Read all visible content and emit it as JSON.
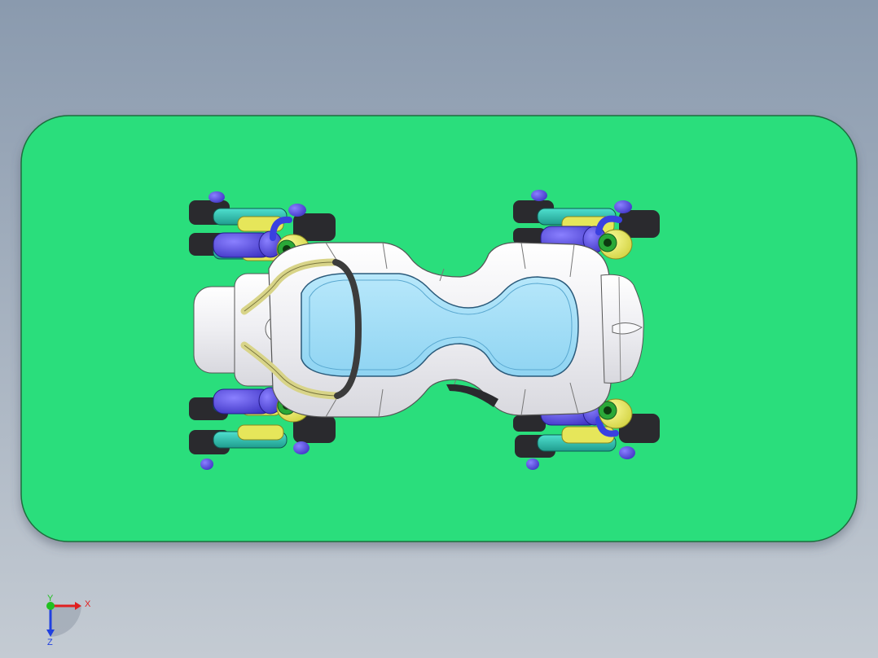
{
  "viewport": {
    "background_top": "#8a9aae",
    "background_bottom": "#c4cbd3"
  },
  "model": {
    "base_plate_color": "#2bde7b",
    "body_color": "#f2f2f4",
    "canopy_color": "#9ddcf6",
    "actuator_color": "#4a3fd8",
    "hinge_color": "#e8e85a",
    "handle_color": "#3c3c3c",
    "hose_color": "#e0dc9a"
  },
  "triad": {
    "x_label": "X",
    "y_label": "Y",
    "z_label": "Z",
    "x_color": "#e02020",
    "y_color": "#20c020",
    "z_color": "#2040e0"
  }
}
